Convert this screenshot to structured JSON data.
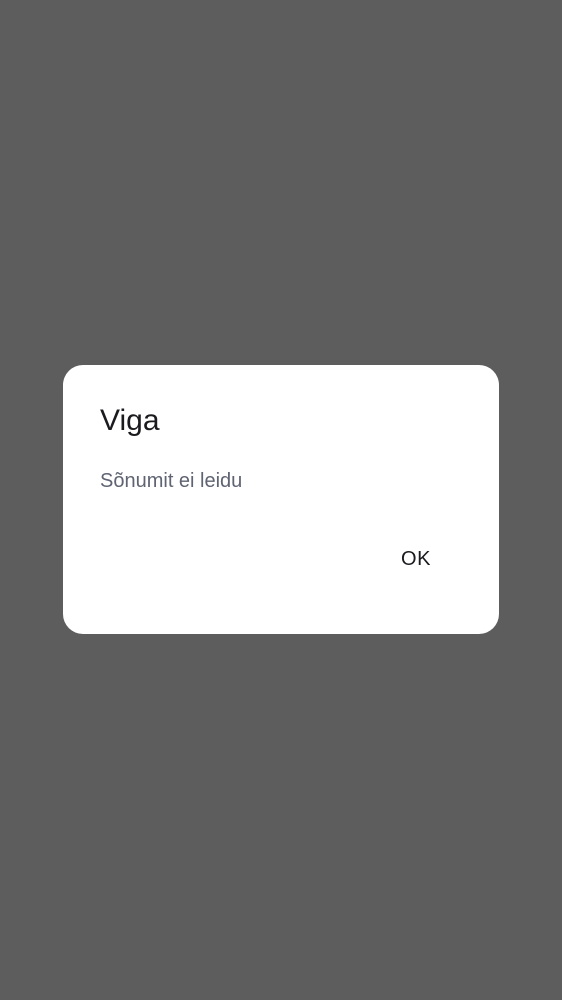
{
  "dialog": {
    "title": "Viga",
    "message": "Sõnumit ei leidu",
    "ok_label": "OK"
  },
  "colors": {
    "scrim": "#5d5d5d",
    "dialog_background": "#ffffff",
    "title_text": "#1b1b1f",
    "message_text": "#5f6372"
  }
}
